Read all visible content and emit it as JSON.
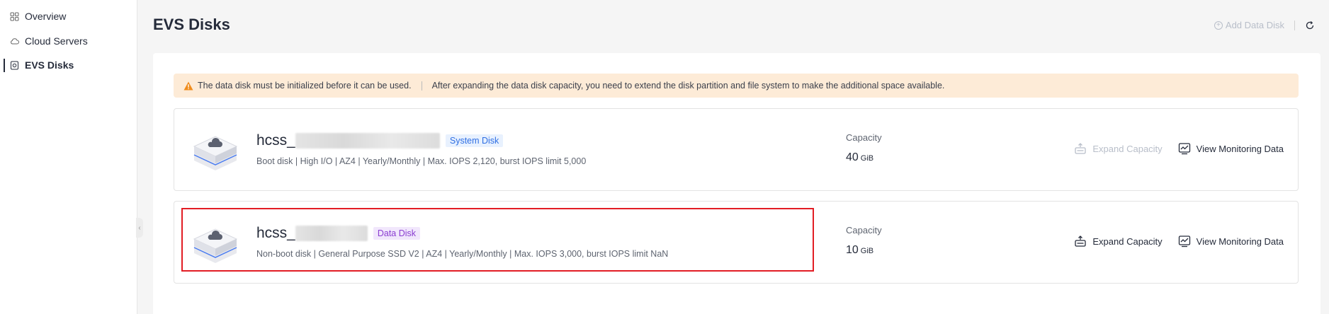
{
  "sidebar": {
    "items": [
      {
        "label": "Overview",
        "icon": "grid-icon"
      },
      {
        "label": "Cloud Servers",
        "icon": "cloud-icon"
      },
      {
        "label": "EVS Disks",
        "icon": "disk-icon",
        "active": true
      }
    ]
  },
  "header": {
    "title": "EVS Disks",
    "add_disk_label": "Add Data Disk"
  },
  "alert": {
    "message_1": "The data disk must be initialized before it can be used.",
    "message_2": "After expanding the data disk capacity, you need to extend the disk partition and file system to make the additional space available."
  },
  "disks": [
    {
      "name_prefix": "hcss_",
      "type_tag": "System Disk",
      "description": "Boot disk | High I/O | AZ4 | Yearly/Monthly | Max. IOPS 2,120, burst IOPS limit 5,000",
      "capacity_label": "Capacity",
      "capacity_value": "40",
      "capacity_unit": "GiB",
      "expand_label": "Expand Capacity",
      "expand_enabled": false,
      "monitor_label": "View Monitoring Data"
    },
    {
      "name_prefix": "hcss_",
      "type_tag": "Data Disk",
      "description": "Non-boot disk | General Purpose SSD V2 | AZ4 | Yearly/Monthly | Max. IOPS 3,000, burst IOPS limit NaN",
      "capacity_label": "Capacity",
      "capacity_value": "10",
      "capacity_unit": "GiB",
      "expand_label": "Expand Capacity",
      "expand_enabled": true,
      "monitor_label": "View Monitoring Data"
    }
  ],
  "colors": {
    "accent_system_tag": "#2f6fe4",
    "accent_data_tag": "#8a3dd1",
    "alert_bg": "#fdebd7",
    "highlight_border": "#e21d24"
  }
}
